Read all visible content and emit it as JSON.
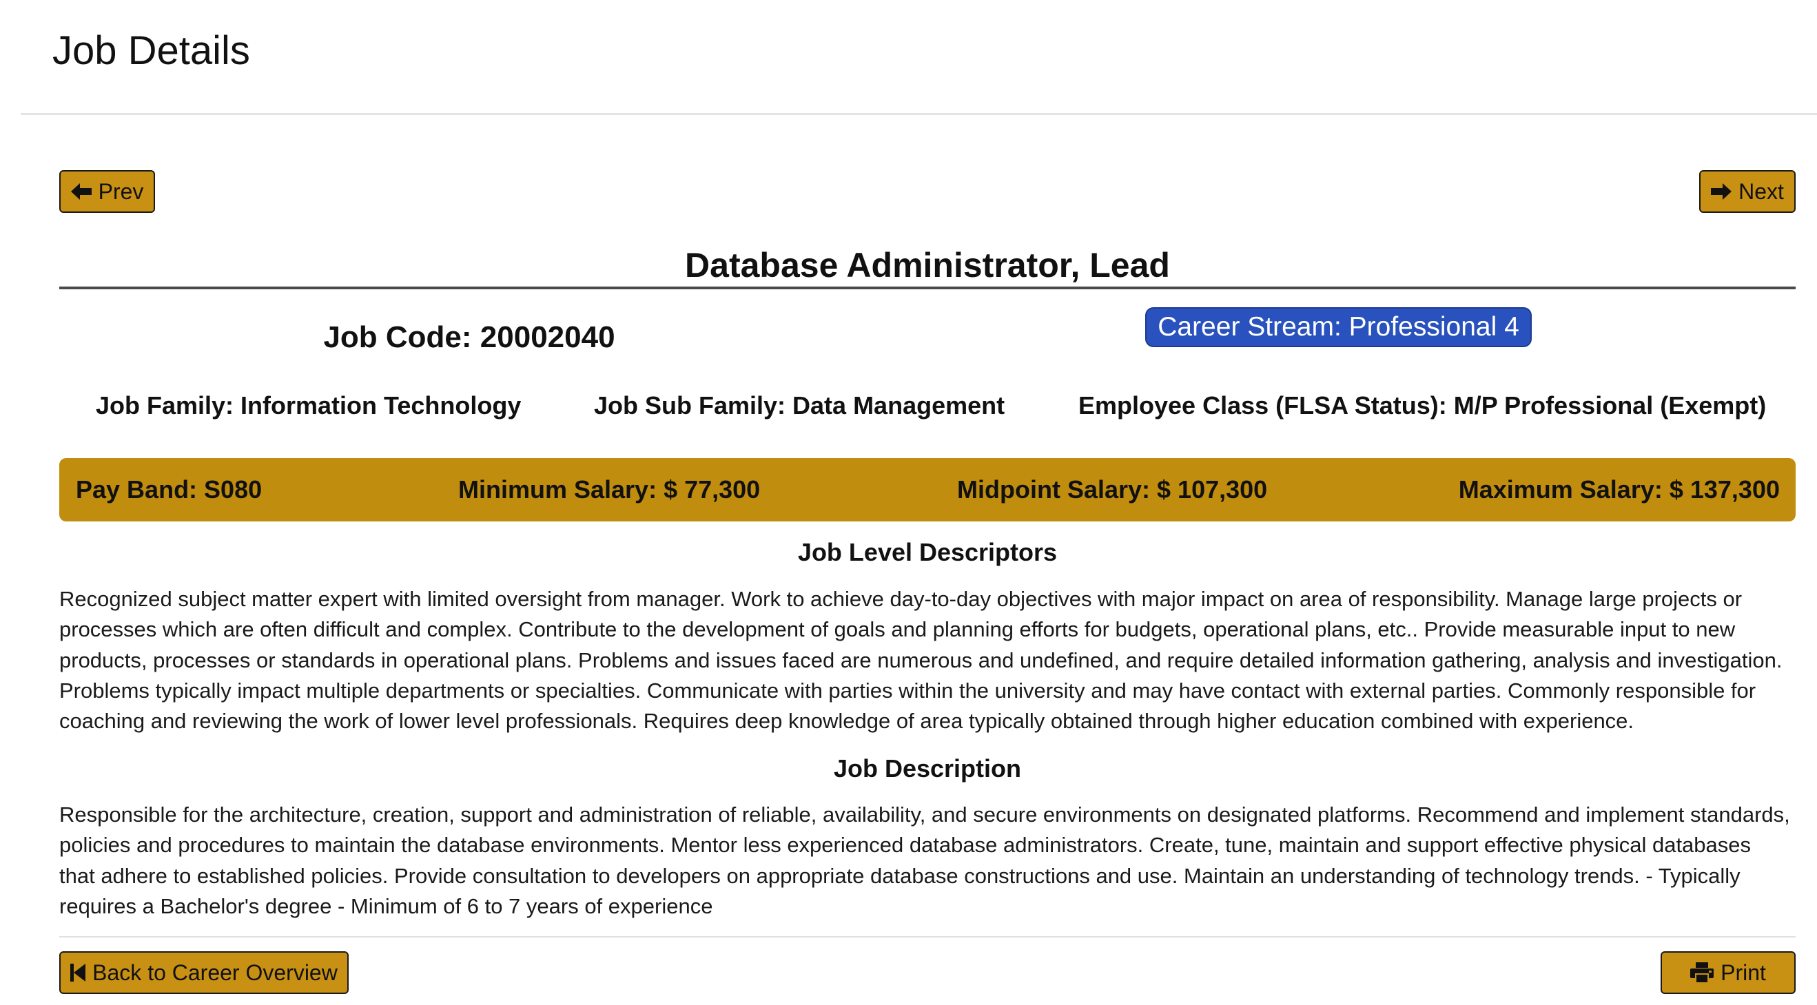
{
  "page": {
    "title": "Job Details"
  },
  "nav": {
    "prev_label": "Prev",
    "next_label": "Next",
    "back_label": "Back to Career Overview",
    "print_label": "Print"
  },
  "job": {
    "title": "Database Administrator, Lead",
    "code_text": "Job Code: 20002040",
    "career_stream": "Career Stream: Professional 4",
    "family": "Job Family: Information Technology",
    "sub_family": "Job Sub Family: Data Management",
    "employee_class": "Employee Class (FLSA Status): M/P Professional (Exempt)"
  },
  "pay": {
    "band": "Pay Band: S080",
    "minimum": "Minimum Salary: $ 77,300",
    "midpoint": "Midpoint Salary: $ 107,300",
    "maximum": "Maximum Salary: $ 137,300"
  },
  "descriptors": {
    "heading": "Job Level Descriptors",
    "lines": [
      "Recognized subject matter expert with limited oversight from manager. Work to achieve day-to-day objectives with major impact on area of responsibility. Manage large projects or",
      "processes which are often difficult and complex. Contribute to the development of goals and planning efforts for budgets, operational plans, etc.. Provide measurable input to new",
      "products, processes or standards in operational plans. Problems and issues faced are numerous and undefined, and require detailed information gathering, analysis and investigation.",
      "Problems typically impact multiple departments or specialties. Communicate with parties within the university and may have contact with external parties. Commonly responsible for",
      "coaching and reviewing the work of lower level professionals. Requires deep knowledge of area typically obtained through higher education combined with experience."
    ]
  },
  "description": {
    "heading": "Job Description",
    "lines": [
      "Responsible for the architecture, creation, support and administration of reliable, availability, and secure environments on designated platforms. Recommend and implement standards,",
      "policies and procedures to maintain the database environments. Mentor less experienced database administrators. Create, tune, maintain and support effective physical databases",
      "that adhere to established policies. Provide consultation to developers on appropriate database constructions and use. Maintain an understanding of technology trends. - Typically",
      "requires a Bachelor's degree - Minimum of 6 to 7 years of experience"
    ]
  },
  "icons": {
    "prev": "arrow-left-icon",
    "next": "arrow-right-icon",
    "back": "step-backward-icon",
    "print": "printer-icon"
  },
  "colors": {
    "accent_gold": "#c18d0e",
    "badge_blue": "#2a52be"
  }
}
